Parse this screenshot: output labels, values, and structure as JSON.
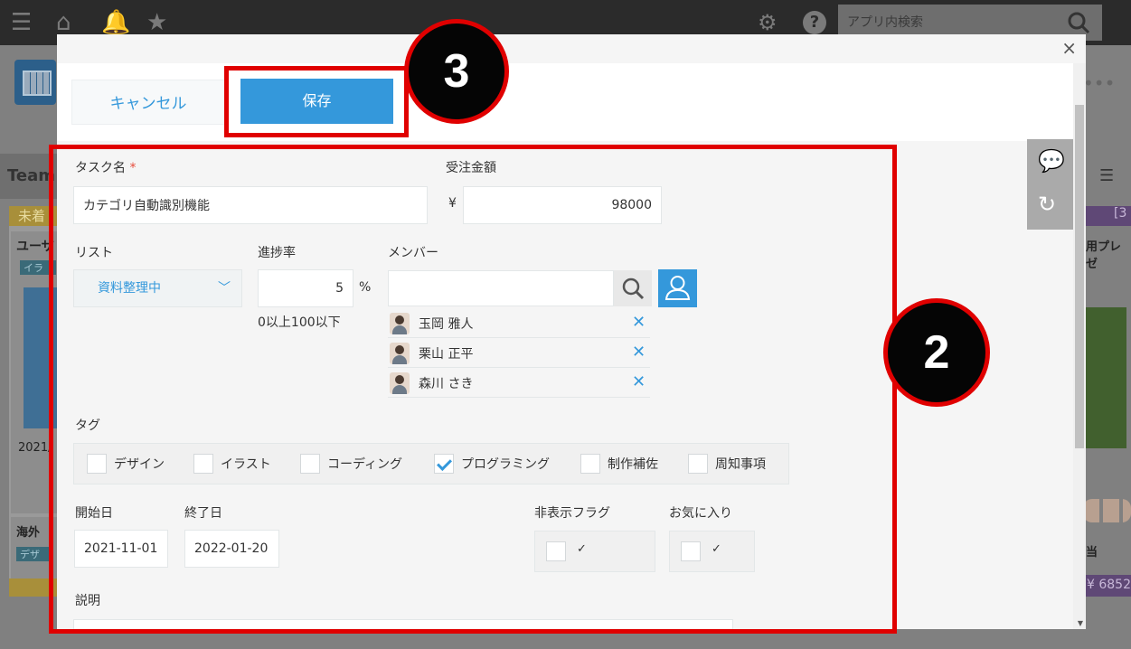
{
  "background_app": {
    "search_placeholder": "アプリ内検索",
    "band_label": "Team",
    "col_head": "未着",
    "card1_title": "ユーザ",
    "card1_tag": "イラ",
    "card1_date": "2021/",
    "card2_title": "海外",
    "card2_tag": "デザ",
    "right_head": "[3",
    "right_text": "用プレゼ",
    "right_text2": "当",
    "right_price": "¥ 6852"
  },
  "modal": {
    "close_icon": "×",
    "toolbar": {
      "cancel_label": "キャンセル",
      "save_label": "保存"
    },
    "form": {
      "task_name_label": "タスク名",
      "required_mark": "*",
      "task_name_value": "カテゴリ自動識別機能",
      "order_amount_label": "受注金額",
      "currency": "¥",
      "order_amount_value": "98000",
      "list_label": "リスト",
      "list_value": "資料整理中",
      "progress_label": "進捗率",
      "progress_value": "5",
      "progress_unit": "%",
      "progress_hint": "0以上100以下",
      "member_label": "メンバー",
      "members": [
        {
          "name": "玉岡 雅人"
        },
        {
          "name": "栗山 正平"
        },
        {
          "name": "森川 さき"
        }
      ],
      "tag_label": "タグ",
      "tags": [
        {
          "label": "デザイン",
          "checked": false
        },
        {
          "label": "イラスト",
          "checked": false
        },
        {
          "label": "コーディング",
          "checked": false
        },
        {
          "label": "プログラミング",
          "checked": true
        },
        {
          "label": "制作補佐",
          "checked": false
        },
        {
          "label": "周知事項",
          "checked": false
        }
      ],
      "start_date_label": "開始日",
      "start_date_value": "2021-11-01",
      "end_date_label": "終了日",
      "end_date_value": "2022-01-20",
      "hidden_flag_label": "非表示フラグ",
      "favorite_label": "お気に入り",
      "check_mark": "✓",
      "description_label": "説明"
    }
  },
  "annotations": {
    "badge_save": "3",
    "badge_form": "2"
  },
  "colors": {
    "accent": "#3498db",
    "annotation_red": "#e00000",
    "required": "#e74c3c"
  }
}
